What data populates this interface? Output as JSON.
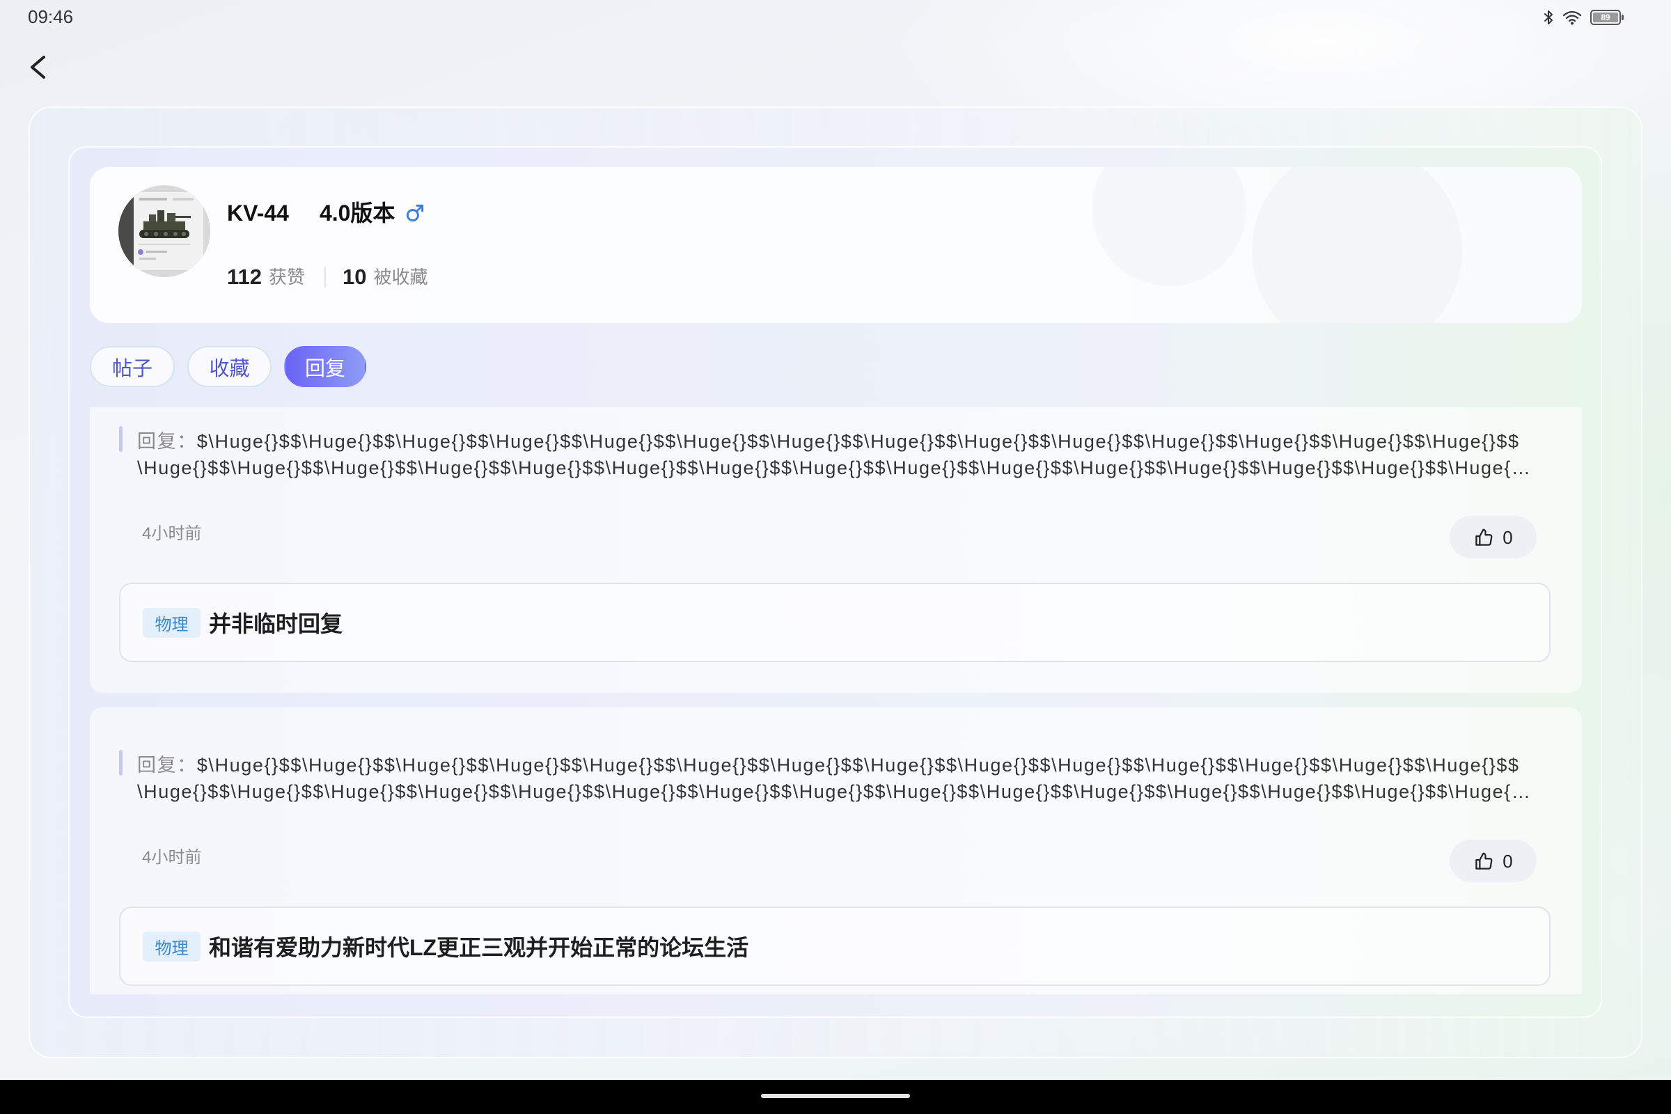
{
  "status_bar": {
    "time": "09:46",
    "battery": "89"
  },
  "icons": {
    "back": "chevron-left-icon",
    "bluetooth": "bluetooth-icon",
    "wifi": "wifi-icon",
    "battery": "battery-icon",
    "gender": "male-icon",
    "like": "thumbs-up-icon"
  },
  "profile": {
    "name": "KV-44",
    "version": "4.0版本",
    "likes_count": "112",
    "likes_label": "获赞",
    "favorites_count": "10",
    "favorites_label": "被收藏"
  },
  "tabs": [
    {
      "label": "帖子",
      "active": false
    },
    {
      "label": "收藏",
      "active": false
    },
    {
      "label": "回复",
      "active": true
    }
  ],
  "replies": [
    {
      "prefix": "回复：",
      "lines": [
        "$\\Huge{}$$\\Huge{}$$\\Huge{}$$\\Huge{}$$\\Huge{}$$\\Huge{}$$\\Huge{}$$\\Huge{}$$\\Huge{}$$\\Huge{}$$\\Huge{}$$\\Huge{}$$\\Huge{}$$\\Huge{}$$",
        "\\Huge{}$$\\Huge{}$$\\Huge{}$$\\Huge{}$$\\Huge{}$$\\Huge{}$$\\Huge{}$$\\Huge{}$$\\Huge{}$$\\Huge{}$$\\Huge{}$$\\Huge{}$$\\Huge{}$$\\Huge{}$$\\Huge{…"
      ],
      "time": "4小时前",
      "like_count": "0",
      "post": {
        "tag": "物理",
        "title": "并非临时回复"
      }
    },
    {
      "prefix": "回复：",
      "lines": [
        "$\\Huge{}$$\\Huge{}$$\\Huge{}$$\\Huge{}$$\\Huge{}$$\\Huge{}$$\\Huge{}$$\\Huge{}$$\\Huge{}$$\\Huge{}$$\\Huge{}$$\\Huge{}$$\\Huge{}$$\\Huge{}$$",
        "\\Huge{}$$\\Huge{}$$\\Huge{}$$\\Huge{}$$\\Huge{}$$\\Huge{}$$\\Huge{}$$\\Huge{}$$\\Huge{}$$\\Huge{}$$\\Huge{}$$\\Huge{}$$\\Huge{}$$\\Huge{}$$\\Huge{…"
      ],
      "time": "4小时前",
      "like_count": "0",
      "post": {
        "tag": "物理",
        "title": "和谐有爱助力新时代LZ更正三观并开始正常的论坛生活"
      }
    }
  ],
  "colors": {
    "accent_start": "#6a63f5",
    "accent_end": "#8d9cf6",
    "tab_text": "#4f56c8",
    "tag_bg": "#e3f0fb",
    "tag_text": "#3b86c6",
    "gender": "#3d7fd8",
    "accent_bar": "#c8c6f2"
  }
}
